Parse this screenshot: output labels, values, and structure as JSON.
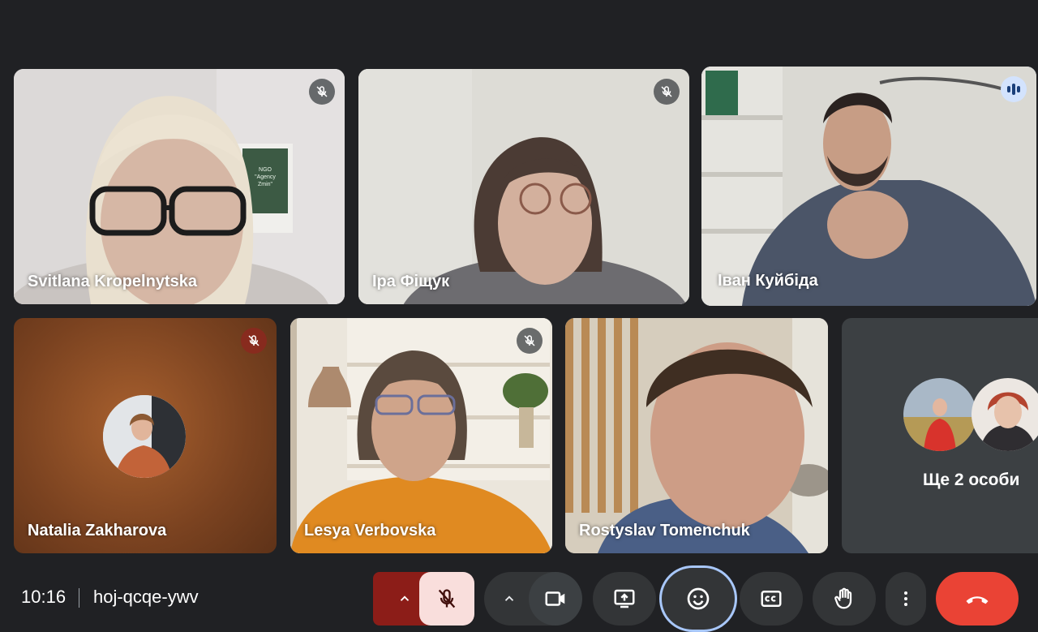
{
  "participants": [
    {
      "name": "Svitlana Kropelnytska",
      "muted": true
    },
    {
      "name": "Іра Фіщук",
      "muted": true
    },
    {
      "name": "Іван Куйбіда",
      "speaking": true
    },
    {
      "name": "Natalia Zakharova",
      "muted": true,
      "camera_off": true
    },
    {
      "name": "Lesya Verbovska",
      "muted": true
    },
    {
      "name": "Rostyslav Tomenchuk"
    }
  ],
  "others": {
    "label": "Ще 2 особи"
  },
  "poster": {
    "line1": "NGO",
    "line2": "\"Agency",
    "line3": "Zmin\""
  },
  "bottom_bar": {
    "time": "10:16",
    "meeting_code": "hoj-qcqe-ywv",
    "controls": [
      {
        "id": "mic-options",
        "icon": "chevron-up-icon"
      },
      {
        "id": "mic",
        "icon": "mic-off-icon",
        "state": "muted"
      },
      {
        "id": "camera-options",
        "icon": "chevron-up-icon"
      },
      {
        "id": "camera",
        "icon": "camera-icon"
      },
      {
        "id": "present",
        "icon": "present-screen-icon"
      },
      {
        "id": "reactions",
        "icon": "emoji-icon",
        "state": "active"
      },
      {
        "id": "captions",
        "icon": "captions-icon"
      },
      {
        "id": "raise-hand",
        "icon": "hand-icon"
      },
      {
        "id": "more",
        "icon": "more-vert-icon"
      },
      {
        "id": "leave",
        "icon": "end-call-icon"
      }
    ]
  },
  "colors": {
    "background": "#202124",
    "leave": "#ea4335",
    "mic_muted_bg": "#f9dedc",
    "mic_options_bg": "#8c1d18",
    "active_ring": "#a8c7fa"
  }
}
